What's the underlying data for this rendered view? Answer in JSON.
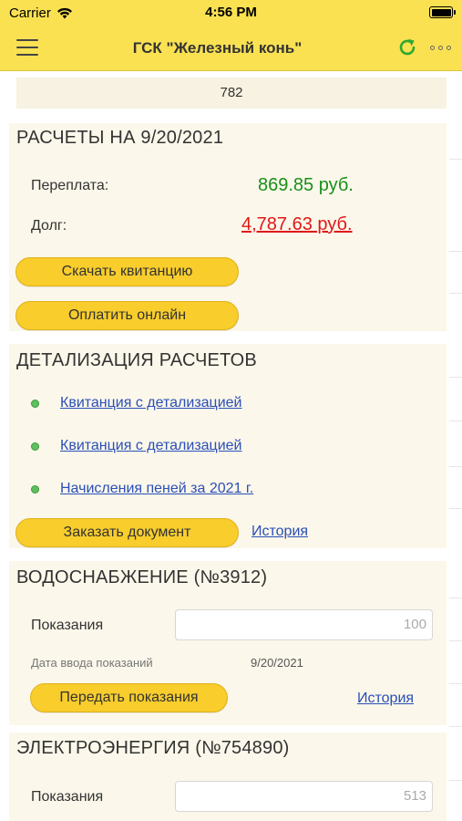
{
  "status": {
    "carrier": "Carrier",
    "time": "4:56 PM"
  },
  "nav": {
    "title": "ГСК \"Железный конь\""
  },
  "account": {
    "number": "782"
  },
  "settlements": {
    "title": "РАСЧЕТЫ НА 9/20/2021",
    "overpay_label": "Переплата:",
    "overpay_value": "869.85 руб.",
    "debt_label": "Долг:",
    "debt_value": "4,787.63 руб.",
    "download_button": "Скачать квитанцию",
    "pay_button": "Оплатить онлайн"
  },
  "details": {
    "title": "ДЕТАЛИЗАЦИЯ РАСЧЕТОВ",
    "items": [
      "Квитанция с детализацией",
      "Квитанция с детализацией",
      "Начисления пеней за 2021 г."
    ],
    "order_button": "Заказать документ",
    "history_link": "История"
  },
  "water": {
    "title": "ВОДОСНАБЖЕНИЕ (№3912)",
    "reading_label": "Показания",
    "reading_placeholder": "100",
    "date_label": "Дата ввода показаний",
    "date_value": "9/20/2021",
    "submit_button": "Передать показания",
    "history_link": "История"
  },
  "electricity": {
    "title": "ЭЛЕКТРОЭНЕРГИЯ (№754890)",
    "reading_label": "Показания",
    "reading_placeholder": "513"
  },
  "colors": {
    "brand_yellow": "#f9e152",
    "button_yellow": "#f8cd2c",
    "overpay_green": "#1a8f1a",
    "debt_red": "#e01818",
    "link_blue": "#2a4fb8",
    "panel_bg": "#fbf7ea"
  },
  "icons": {
    "wifi": "wifi-icon",
    "battery": "battery-icon",
    "menu": "hamburger-menu-icon",
    "refresh": "refresh-icon",
    "more": "more-dots-icon",
    "bullet": "green-bullet-icon"
  }
}
